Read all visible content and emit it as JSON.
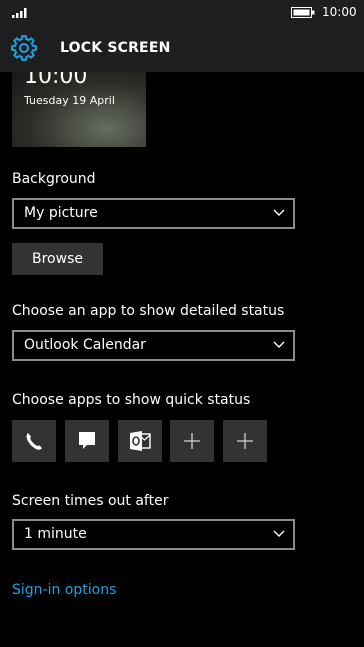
{
  "status_bar": {
    "time": "10:00",
    "icons": [
      "signal-icon",
      "battery-icon"
    ]
  },
  "header": {
    "title": "LOCK SCREEN",
    "icon": "gear-icon",
    "accent_color": "#1ba1e2"
  },
  "preview": {
    "time": "10:00",
    "date": "Tuesday 19 April"
  },
  "background": {
    "label": "Background",
    "selected": "My picture",
    "browse_label": "Browse"
  },
  "detailed_status": {
    "label": "Choose an app to show detailed status",
    "selected": "Outlook Calendar"
  },
  "quick_status": {
    "label": "Choose apps to show quick status",
    "slots": [
      {
        "icon": "phone-icon"
      },
      {
        "icon": "message-icon"
      },
      {
        "icon": "outlook-icon"
      },
      {
        "icon": "add-icon"
      },
      {
        "icon": "add-icon"
      }
    ]
  },
  "timeout": {
    "label": "Screen times out after",
    "selected": "1 minute"
  },
  "sign_in_link": "Sign-in options"
}
